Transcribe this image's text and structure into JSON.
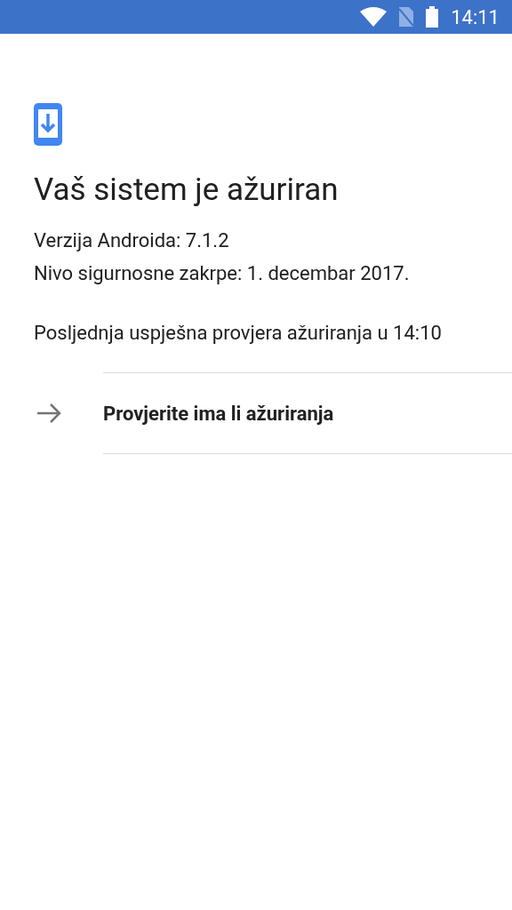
{
  "status_bar": {
    "time": "14:11"
  },
  "title": "Vaš sistem je ažuriran",
  "info_lines": [
    "Verzija Androida: 7.1.2",
    "Nivo sigurnosne zakrpe: 1. decembar 2017."
  ],
  "last_check": "Posljednja uspješna provjera ažuriranja u 14:10",
  "action": {
    "label": "Provjerite ima li ažuriranja"
  }
}
